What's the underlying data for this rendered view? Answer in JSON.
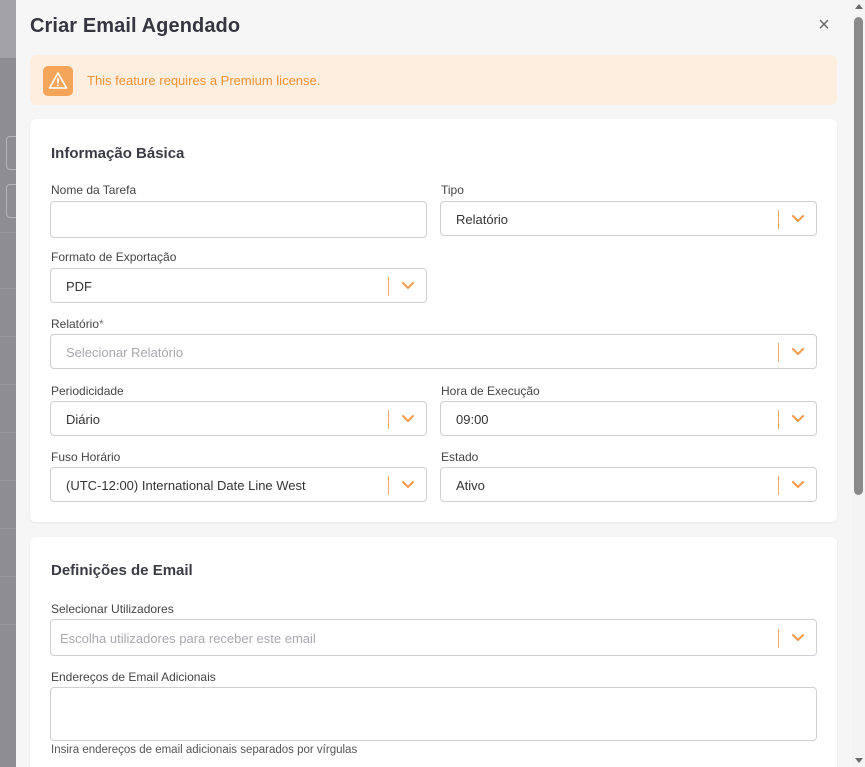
{
  "modal": {
    "title": "Criar Email Agendado",
    "close_icon": "close-icon",
    "close_glyph": "×"
  },
  "alert": {
    "icon": "warning-icon",
    "text": "This feature requires a Premium license."
  },
  "basic_info": {
    "title": "Informação Básica",
    "task_name": {
      "label": "Nome da Tarefa",
      "value": ""
    },
    "type": {
      "label": "Tipo",
      "value": "Relatório"
    },
    "export_format": {
      "label": "Formato de Exportação",
      "value": "PDF"
    },
    "report": {
      "label": "Relatório",
      "required_mark": "*",
      "placeholder": "Selecionar Relatório"
    },
    "periodicity": {
      "label": "Periodicidade",
      "value": "Diário"
    },
    "execution_time": {
      "label": "Hora de Execução",
      "value": "09:00"
    },
    "timezone": {
      "label": "Fuso Horário",
      "value": "(UTC-12:00) International Date Line West"
    },
    "state": {
      "label": "Estado",
      "value": "Ativo"
    }
  },
  "email_settings": {
    "title": "Definições de Email",
    "select_users": {
      "label": "Selecionar Utilizadores",
      "placeholder": "Escolha utilizadores para receber este email"
    },
    "additional_emails": {
      "label": "Endereços de Email Adicionais",
      "value": "",
      "help": "Insira endereços de email adicionais separados por vírgulas"
    }
  },
  "colors": {
    "accent": "#f39a4c",
    "alert_bg": "#fdeee0",
    "alert_text": "#f09135"
  }
}
